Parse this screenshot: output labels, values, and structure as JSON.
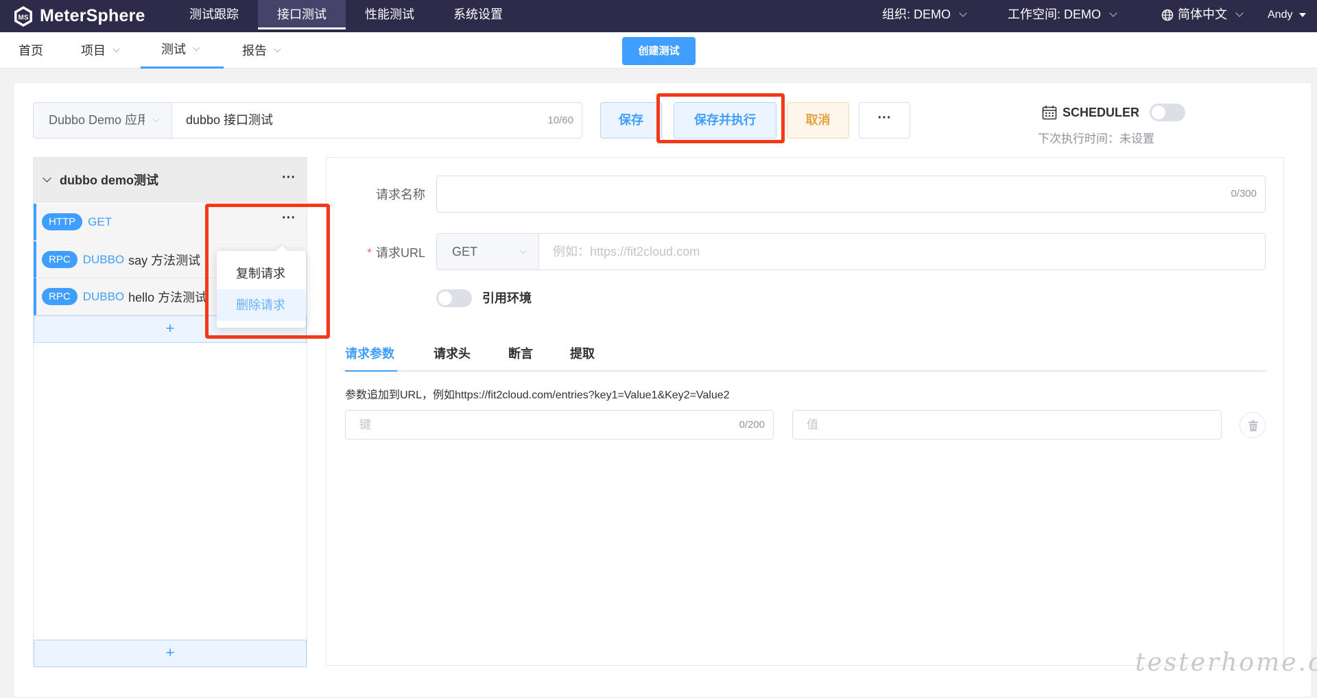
{
  "app": {
    "logo_text": "MeterSphere",
    "logo_mark": "MS"
  },
  "topnav": {
    "items": [
      {
        "label": "测试跟踪"
      },
      {
        "label": "接口测试",
        "active": true
      },
      {
        "label": "性能测试"
      },
      {
        "label": "系统设置"
      }
    ],
    "org": "组织: DEMO",
    "workspace": "工作空间: DEMO",
    "language": "简体中文",
    "user": "Andy"
  },
  "subnav": {
    "home": "首页",
    "project": "项目",
    "test": "测试",
    "report": "报告",
    "create_button": "创建测试"
  },
  "editor": {
    "project_select": "Dubbo Demo 应用",
    "test_name": "dubbo 接口测试",
    "test_name_counter": "10/60",
    "save": "保存",
    "save_and_run": "保存并执行",
    "cancel": "取消",
    "more": "···",
    "scheduler_label": "SCHEDULER",
    "next_run": "下次执行时间：未设置"
  },
  "scenario": {
    "group_title": "dubbo demo测试",
    "group_more": "···",
    "requests": [
      {
        "tag": "HTTP",
        "method": "GET",
        "name": "",
        "more": "···"
      },
      {
        "tag": "RPC",
        "method": "DUBBO",
        "name": "say 方法测试"
      },
      {
        "tag": "RPC",
        "method": "DUBBO",
        "name": "hello 方法测试"
      }
    ],
    "add_label": "+"
  },
  "context_menu": {
    "copy": "复制请求",
    "delete": "删除请求"
  },
  "request_form": {
    "name_label": "请求名称",
    "name_counter": "0/300",
    "url_label": "请求URL",
    "required_mark": "*",
    "method": "GET",
    "url_placeholder": "例如：https://fit2cloud.com",
    "env_label": "引用环境",
    "tabs": [
      "请求参数",
      "请求头",
      "断言",
      "提取"
    ],
    "hint": "参数追加到URL，例如https://fit2cloud.com/entries?key1=Value1&Key2=Value2",
    "key_placeholder": "键",
    "key_counter": "0/200",
    "value_placeholder": "值"
  },
  "watermark": "testerhome.com",
  "colors": {
    "topnav_bg": "#2e2a4a",
    "primary": "#409eff",
    "warning": "#e6a23c",
    "highlight_box": "#f2391a"
  }
}
